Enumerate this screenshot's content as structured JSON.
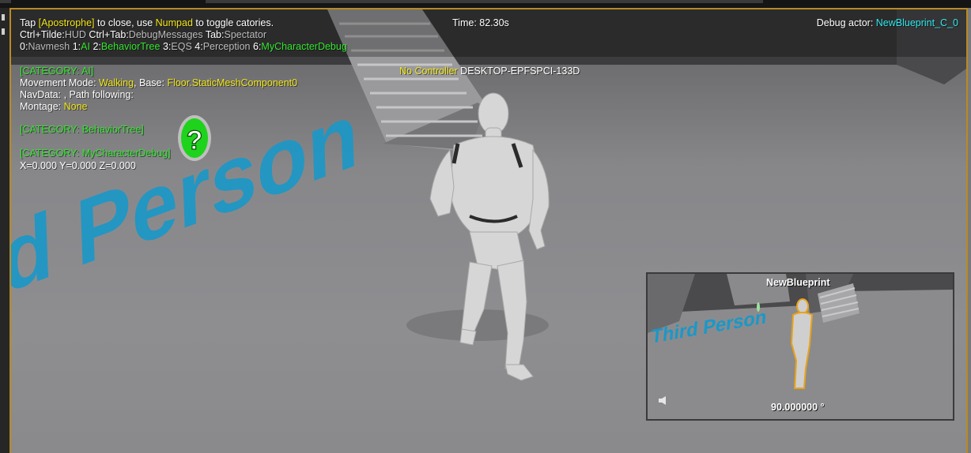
{
  "debug_hud": {
    "line1": {
      "tap": "Tap ",
      "apostrophe": "[Apostrophe]",
      "close": " to close, use ",
      "numpad": "Numpad",
      "toggle": " to toggle catories."
    },
    "line2": {
      "k1": "Ctrl+Tilde:",
      "v1": "HUD",
      "k2": "Ctrl+Tab:",
      "v2": "DebugMessages",
      "k3": "Tab:",
      "v3": "Spectator"
    },
    "categories": [
      {
        "key": "0:",
        "name": "Navmesh"
      },
      {
        "key": "1:",
        "name": "AI"
      },
      {
        "key": "2:",
        "name": "BehaviorTree"
      },
      {
        "key": "3:",
        "name": "EQS"
      },
      {
        "key": "4:",
        "name": "Perception"
      },
      {
        "key": "6:",
        "name": "MyCharacterDebug"
      }
    ],
    "time": "Time: 82.30s",
    "debug_actor_label": "Debug actor: ",
    "debug_actor_value": "NewBlueprint_C_0",
    "no_controller": "No Controller",
    "machine_name": " DESKTOP-EPFSPCI-133D",
    "ai": {
      "header": "[CATEGORY: AI]",
      "movement_label": "Movement Mode: ",
      "movement_value": "Walking",
      "base_label": ", Base: ",
      "base_value": "Floor.StaticMeshComponent0",
      "navdata": "NavData: , Path following:",
      "montage_label": "Montage: ",
      "montage_value": "None"
    },
    "behavior_tree_header": "[CATEGORY: BehaviorTree]",
    "my_character_header": "[CATEGORY: MyCharacterDebug]",
    "coords": "X=0.000 Y=0.000 Z=0.000"
  },
  "floor_text": "d Person",
  "pip": {
    "title": "NewBlueprint",
    "floor_text": "Third Person",
    "angle": "90.000000 °"
  },
  "colors": {
    "accent_yellow": "#f2e616",
    "category_green": "#34e62f",
    "actor_cyan": "#2fe9ee",
    "viewport_border": "#b98a25",
    "floor_text": "#1a98c8"
  }
}
